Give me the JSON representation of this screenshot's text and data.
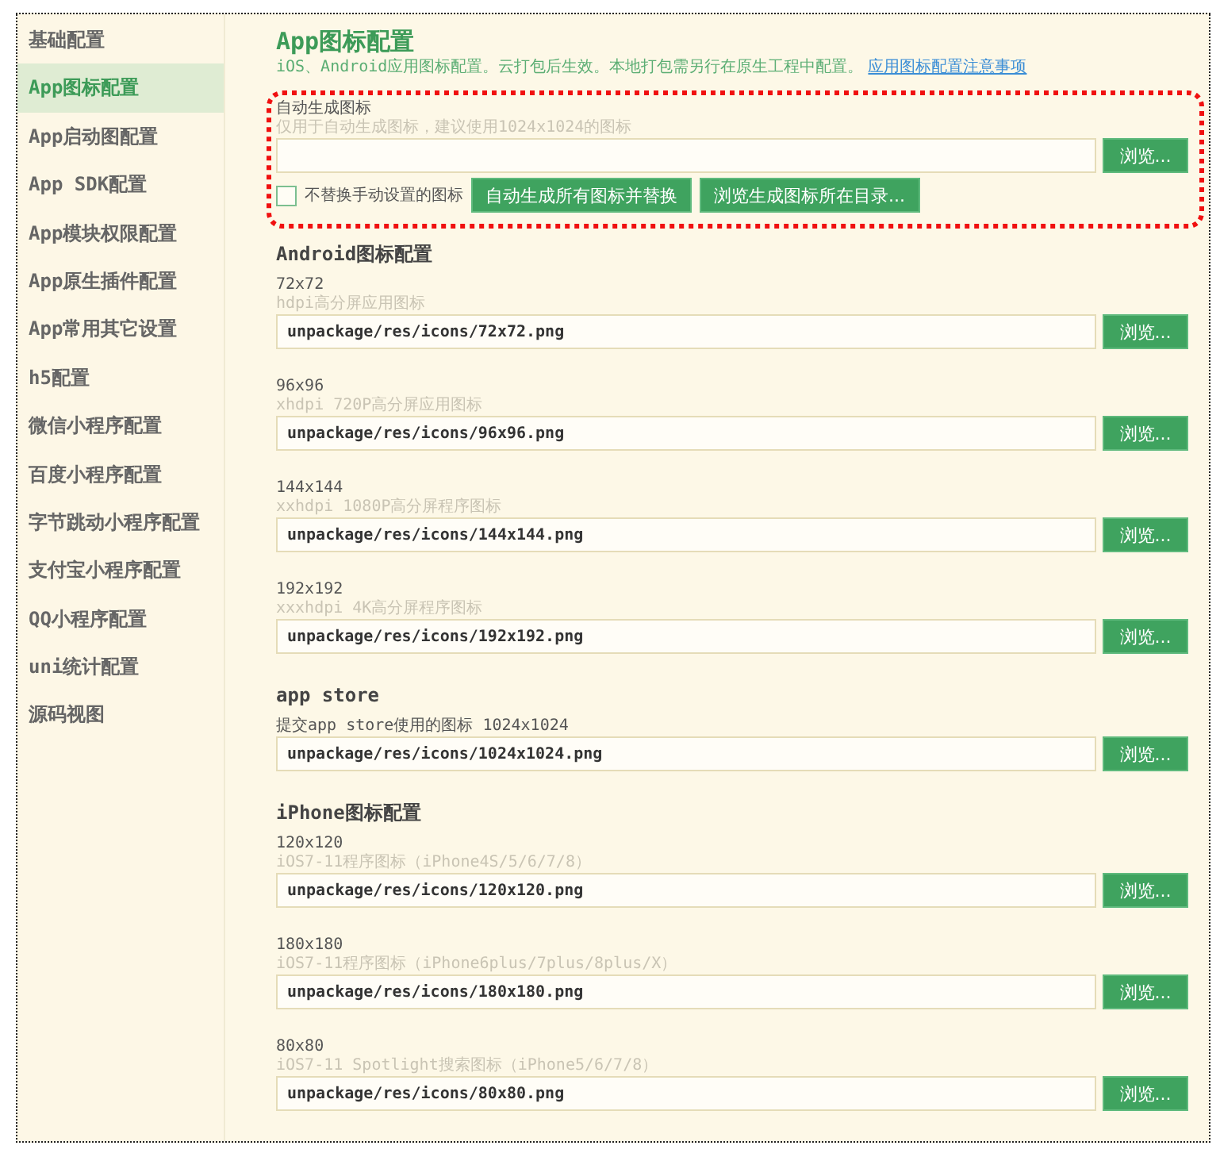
{
  "sidebar": {
    "items": [
      {
        "label": "基础配置",
        "selected": false
      },
      {
        "label": "App图标配置",
        "selected": true
      },
      {
        "label": "App启动图配置",
        "selected": false
      },
      {
        "label": "App SDK配置",
        "selected": false
      },
      {
        "label": "App模块权限配置",
        "selected": false
      },
      {
        "label": "App原生插件配置",
        "selected": false
      },
      {
        "label": "App常用其它设置",
        "selected": false
      },
      {
        "label": "h5配置",
        "selected": false
      },
      {
        "label": "微信小程序配置",
        "selected": false
      },
      {
        "label": "百度小程序配置",
        "selected": false
      },
      {
        "label": "字节跳动小程序配置",
        "selected": false
      },
      {
        "label": "支付宝小程序配置",
        "selected": false
      },
      {
        "label": "QQ小程序配置",
        "selected": false
      },
      {
        "label": "uni统计配置",
        "selected": false
      },
      {
        "label": "源码视图",
        "selected": false
      }
    ]
  },
  "header": {
    "title": "App图标配置",
    "description": "iOS、Android应用图标配置。云打包后生效。本地打包需另行在原生工程中配置。",
    "link": "应用图标配置注意事项"
  },
  "auto_generate": {
    "label": "自动生成图标",
    "hint": "仅用于自动生成图标，建议使用1024x1024的图标",
    "browse_button": "浏览...",
    "checkbox": {
      "label": "不替换手动设置的图标",
      "checked": false
    },
    "buttons": [
      "自动生成所有图标并替换",
      "浏览生成图标所在目录..."
    ]
  },
  "sections": [
    {
      "title": "Android图标配置",
      "items": [
        {
          "label": "72x72",
          "hint": "hdpi高分屏应用图标",
          "value": "unpackage/res/icons/72x72.png",
          "button": "浏览..."
        },
        {
          "label": "96x96",
          "hint": "xhdpi 720P高分屏应用图标",
          "value": "unpackage/res/icons/96x96.png",
          "button": "浏览..."
        },
        {
          "label": "144x144",
          "hint": "xxhdpi 1080P高分屏程序图标",
          "value": "unpackage/res/icons/144x144.png",
          "button": "浏览..."
        },
        {
          "label": "192x192",
          "hint": "xxxhdpi 4K高分屏程序图标",
          "value": "unpackage/res/icons/192x192.png",
          "button": "浏览..."
        }
      ]
    },
    {
      "title": "app store",
      "items": [
        {
          "label": "提交app store使用的图标 1024x1024",
          "value": "unpackage/res/icons/1024x1024.png",
          "button": "浏览..."
        }
      ]
    },
    {
      "title": "iPhone图标配置",
      "items": [
        {
          "label": "120x120",
          "hint": "iOS7-11程序图标（iPhone4S/5/6/7/8）",
          "value": "unpackage/res/icons/120x120.png",
          "button": "浏览..."
        },
        {
          "label": "180x180",
          "hint": "iOS7-11程序图标（iPhone6plus/7plus/8plus/X）",
          "value": "unpackage/res/icons/180x180.png",
          "button": "浏览..."
        },
        {
          "label": "80x80",
          "hint": "iOS7-11 Spotlight搜索图标（iPhone5/6/7/8）",
          "value": "unpackage/res/icons/80x80.png",
          "button": "浏览..."
        }
      ]
    }
  ]
}
